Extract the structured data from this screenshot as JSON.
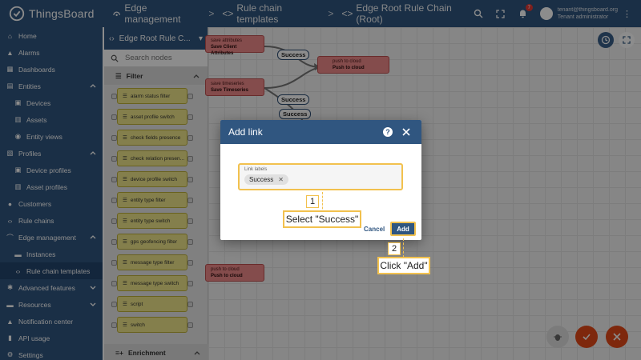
{
  "topbar": {
    "logo": "ThingsBoard",
    "crumbs": [
      "Edge management",
      "Rule chain templates",
      "Edge Root Rule Chain (Root)"
    ],
    "notification_count": "7",
    "user_email": "tenant@thingsboard.org",
    "user_role": "Tenant administrator"
  },
  "nav": {
    "items": [
      {
        "label": "Home",
        "icon": "home-icon"
      },
      {
        "label": "Alarms",
        "icon": "bell-icon"
      },
      {
        "label": "Dashboards",
        "icon": "dashboard-icon"
      },
      {
        "label": "Entities",
        "icon": "entities-icon"
      },
      {
        "label": "Devices",
        "icon": "device-icon"
      },
      {
        "label": "Assets",
        "icon": "asset-icon"
      },
      {
        "label": "Entity views",
        "icon": "entity-view-icon"
      },
      {
        "label": "Profiles",
        "icon": "profiles-icon"
      },
      {
        "label": "Device profiles",
        "icon": "device-profile-icon"
      },
      {
        "label": "Asset profiles",
        "icon": "asset-profile-icon"
      },
      {
        "label": "Customers",
        "icon": "customers-icon"
      },
      {
        "label": "Rule chains",
        "icon": "rule-chains-icon"
      },
      {
        "label": "Edge management",
        "icon": "edge-icon"
      },
      {
        "label": "Instances",
        "icon": "instances-icon"
      },
      {
        "label": "Rule chain templates",
        "icon": "rule-chain-templates-icon"
      },
      {
        "label": "Advanced features",
        "icon": "advanced-icon"
      },
      {
        "label": "Resources",
        "icon": "resources-icon"
      },
      {
        "label": "Notification center",
        "icon": "notification-icon"
      },
      {
        "label": "API usage",
        "icon": "api-usage-icon"
      },
      {
        "label": "Settings",
        "icon": "settings-icon"
      }
    ]
  },
  "panel": {
    "title": "Edge Root Rule C...",
    "search_placeholder": "Search nodes",
    "category_filter": "Filter",
    "category_enrichment": "Enrichment",
    "nodes": [
      "alarm status filter",
      "asset profile switch",
      "check fields presence",
      "check relation presen...",
      "device profile switch",
      "entity type filter",
      "entity type switch",
      "gps geofencing filter",
      "message type filter",
      "message type switch",
      "script",
      "switch"
    ]
  },
  "canvas": {
    "node1_type": "save attributes",
    "node1_name": "Save Client Attributes",
    "node2_type": "push to cloud",
    "node2_name": "Push to cloud",
    "node3_type": "save timeseries",
    "node3_name": "Save Timeseries",
    "node4_type": "push to cloud",
    "node4_name": "Push to cloud",
    "link1": "Success",
    "link2": "Success",
    "link3": "Success"
  },
  "dialog": {
    "title": "Add link",
    "field_label": "Link labels",
    "chip": "Success",
    "cancel": "Cancel",
    "add": "Add"
  },
  "callouts": {
    "step1_num": "1",
    "step1_text": "Select \"Success\"",
    "step2_num": "2",
    "step2_text": "Click \"Add\""
  },
  "colors": {
    "primary": "#305680",
    "node_filter": "#f0e88a",
    "node_action": "#f08a8a",
    "callout": "#f2c14e",
    "fab": "#e64a19"
  }
}
